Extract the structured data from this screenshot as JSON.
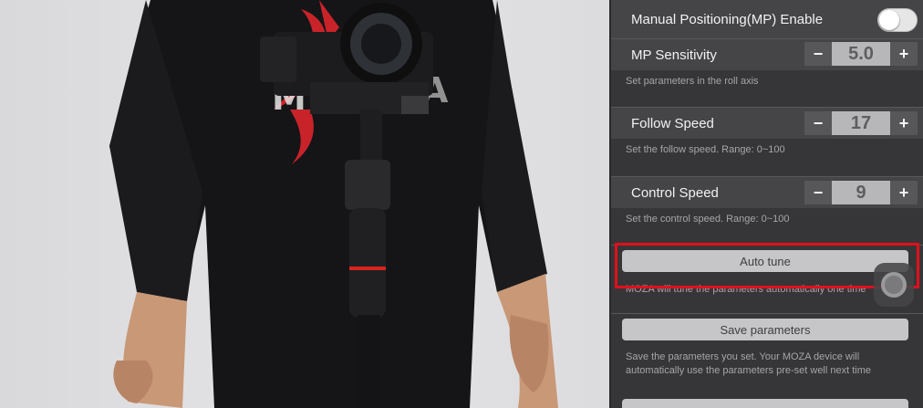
{
  "settings": {
    "mp_enable": {
      "label": "Manual Positioning(MP) Enable",
      "on": false
    },
    "mp_sensitivity": {
      "label": "MP Sensitivity",
      "value": "5.0",
      "minus": "−",
      "plus": "+"
    },
    "roll_note": "Set parameters in the roll axis",
    "follow_speed": {
      "label": "Follow Speed",
      "value": "17",
      "minus": "−",
      "plus": "+"
    },
    "follow_note": "Set the follow speed. Range: 0~100",
    "control_speed": {
      "label": "Control Speed",
      "value": "9",
      "minus": "−",
      "plus": "+"
    },
    "control_note": "Set the control speed. Range: 0~100",
    "auto_tune": {
      "label": "Auto tune",
      "note": "MOZA will tune the parameters automatically one time"
    },
    "save_parameters": {
      "label": "Save parameters",
      "note_line1": "Save the parameters you set. Your MOZA device will",
      "note_line2": "automatically use the parameters pre-set well next time"
    }
  },
  "colors": {
    "highlight": "#e1101a",
    "panel_bg": "#363638",
    "row_bg": "#454548"
  }
}
